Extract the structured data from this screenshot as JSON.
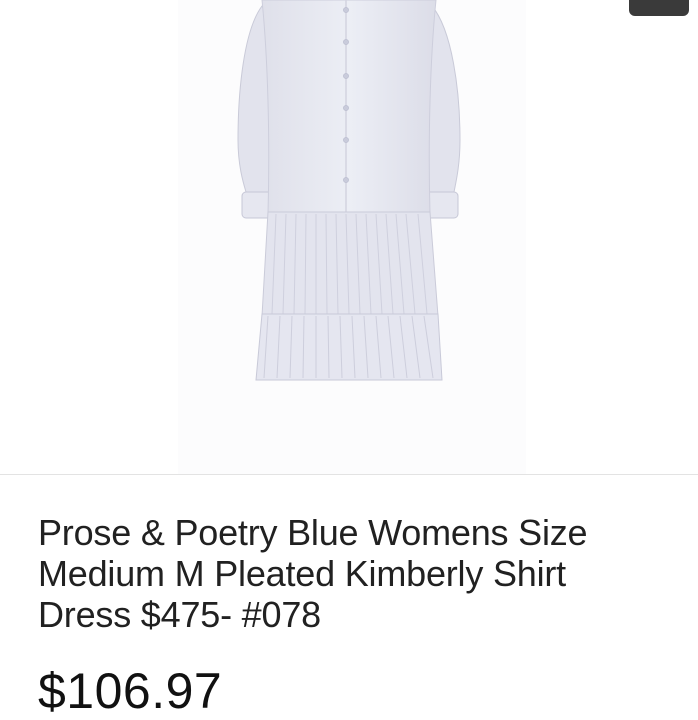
{
  "product": {
    "image_icon": "dress-photo",
    "title": "Prose & Poetry Blue Womens Size Medium M Pleated Kimberly Shirt Dress $475- #078",
    "price": "$106.97"
  },
  "colors": {
    "dress": "#e4e5ef",
    "price_text": "#111111",
    "title_text": "#212121"
  }
}
